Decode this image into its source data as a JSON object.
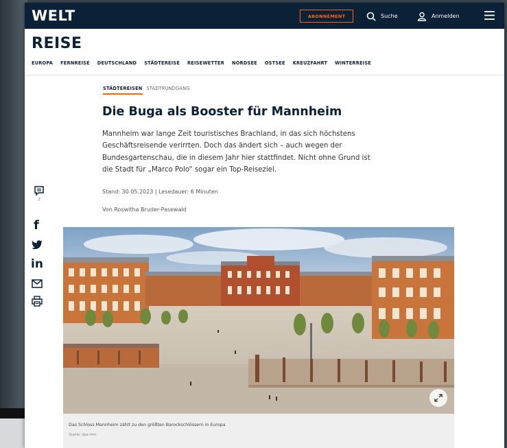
{
  "header": {
    "logo": "WELT",
    "subscribe_label": "ABONNEMENT",
    "search_label": "Suche",
    "login_label": "Anmelden"
  },
  "section": {
    "title": "REISE",
    "nav": [
      "EUROPA",
      "FERNREISE",
      "DEUTSCHLAND",
      "STÄDTEREISE",
      "REISEWETTER",
      "NORDSEE",
      "OSTSEE",
      "KREUZFAHRT",
      "WINTERREISE"
    ]
  },
  "article": {
    "kicker": "STÄDTEREISEN",
    "kicker_sub": "STADTRUNDGANG",
    "headline": "Die Buga als Booster für Mannheim",
    "intro_lines": [
      "Mannheim war lange Zeit touristisches Brachland, in das sich höchstens",
      "Geschäftsreisende verirrten. Doch das ändert sich – auch wegen der",
      "Bundesgartenschau, die in diesem Jahr hier stattfindet. Nicht ohne Grund ist",
      "die Stadt für „Marco Polo“ sogar ein Top-Reiseziel."
    ],
    "meta": "Stand: 30.05.2023 | Lesedauer: 6 Minuten",
    "author": "Von Roswitha Bruder-Pasewald",
    "caption": "Das Schloss Mannheim zählt zu den größten Barockschlössern in Europa",
    "caption_source": "Quelle: dpa-tmn"
  },
  "share": {
    "comment_count": "7",
    "icons": [
      "comment-icon",
      "facebook-icon",
      "twitter-icon",
      "linkedin-icon",
      "mail-icon",
      "print-icon"
    ]
  },
  "colors": {
    "header_bg": "#0a2138",
    "accent": "#ff6600"
  }
}
